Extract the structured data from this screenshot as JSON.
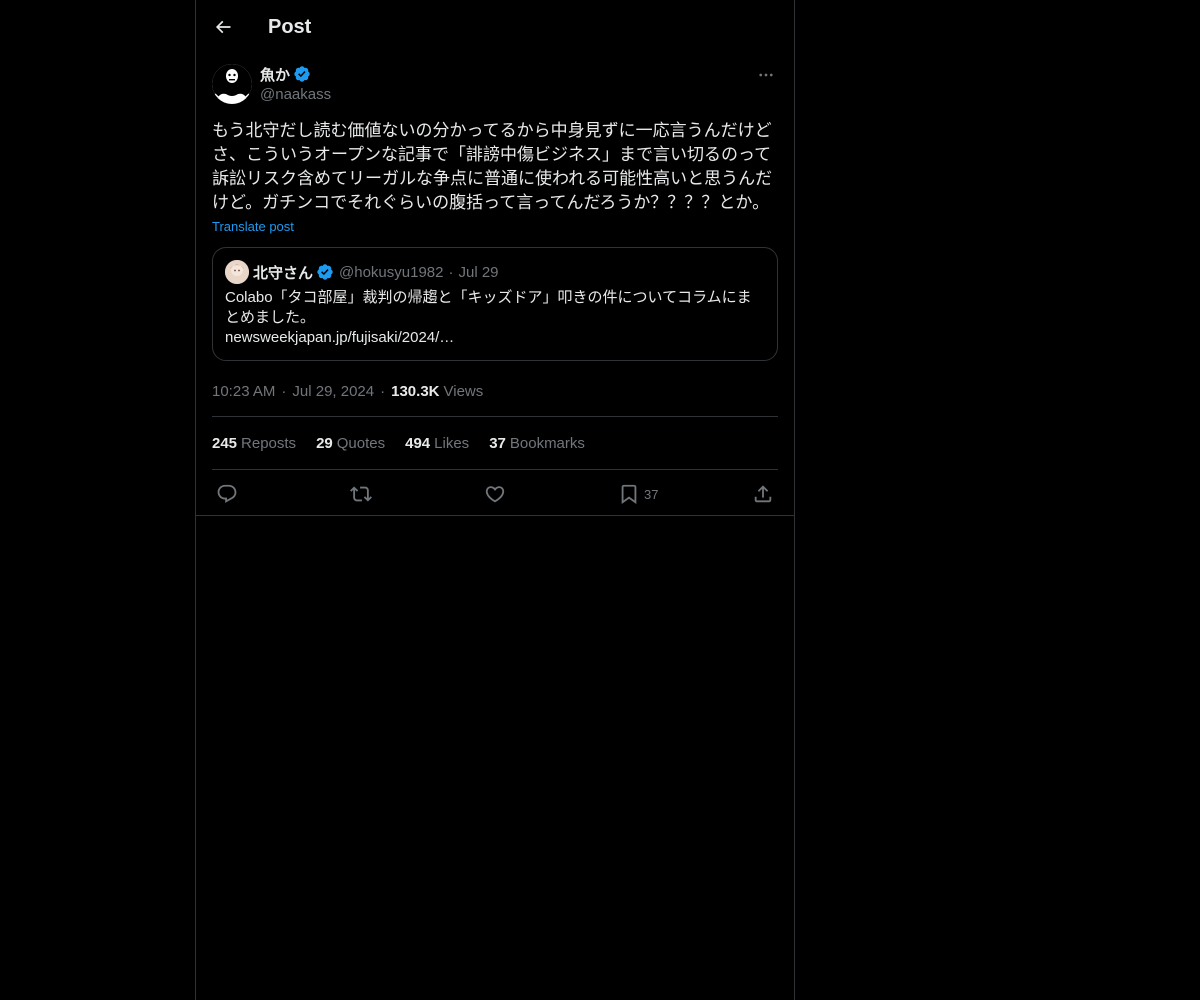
{
  "header": {
    "title": "Post",
    "back_icon": "arrow-left-icon"
  },
  "post": {
    "author": {
      "name": "魚か",
      "handle": "@naakass",
      "verified": true
    },
    "text": "もう北守だし読む価値ないの分かってるから中身見ずに一応言うんだけどさ、こういうオープンな記事で「誹謗中傷ビジネス」まで言い切るのって訴訟リスク含めてリーガルな争点に普通に使われる可能性高いと思うんだけど。ガチンコでそれぐらいの腹括って言ってんだろうか？？？？とか。",
    "translate_label": "Translate post",
    "quote": {
      "name": "北守さん",
      "handle": "@hokusyu1982",
      "dot": "·",
      "date": "Jul 29",
      "verified": true,
      "text_line1": "Colabo「タコ部屋」裁判の帰趨と「キッズドア」叩きの件についてコラムにまとめました。",
      "link": "newsweekjapan.jp/fujisaki/2024/…"
    },
    "meta": {
      "time": "10:23 AM",
      "sep": "·",
      "date": "Jul 29, 2024",
      "views_count": "130.3K",
      "views_label": "Views"
    },
    "stats": {
      "reposts_count": "245",
      "reposts_label": "Reposts",
      "quotes_count": "29",
      "quotes_label": "Quotes",
      "likes_count": "494",
      "likes_label": "Likes",
      "bookmarks_count": "37",
      "bookmarks_label": "Bookmarks"
    },
    "actions": {
      "reply_icon": "reply-icon",
      "repost_icon": "repost-icon",
      "like_icon": "heart-icon",
      "bookmark_icon": "bookmark-icon",
      "bookmark_count": "37",
      "share_icon": "share-icon"
    }
  },
  "colors": {
    "background": "#000000",
    "text": "#e7e9ea",
    "secondary": "#71767b",
    "accent": "#1d9bf0",
    "border": "#2f3336"
  }
}
